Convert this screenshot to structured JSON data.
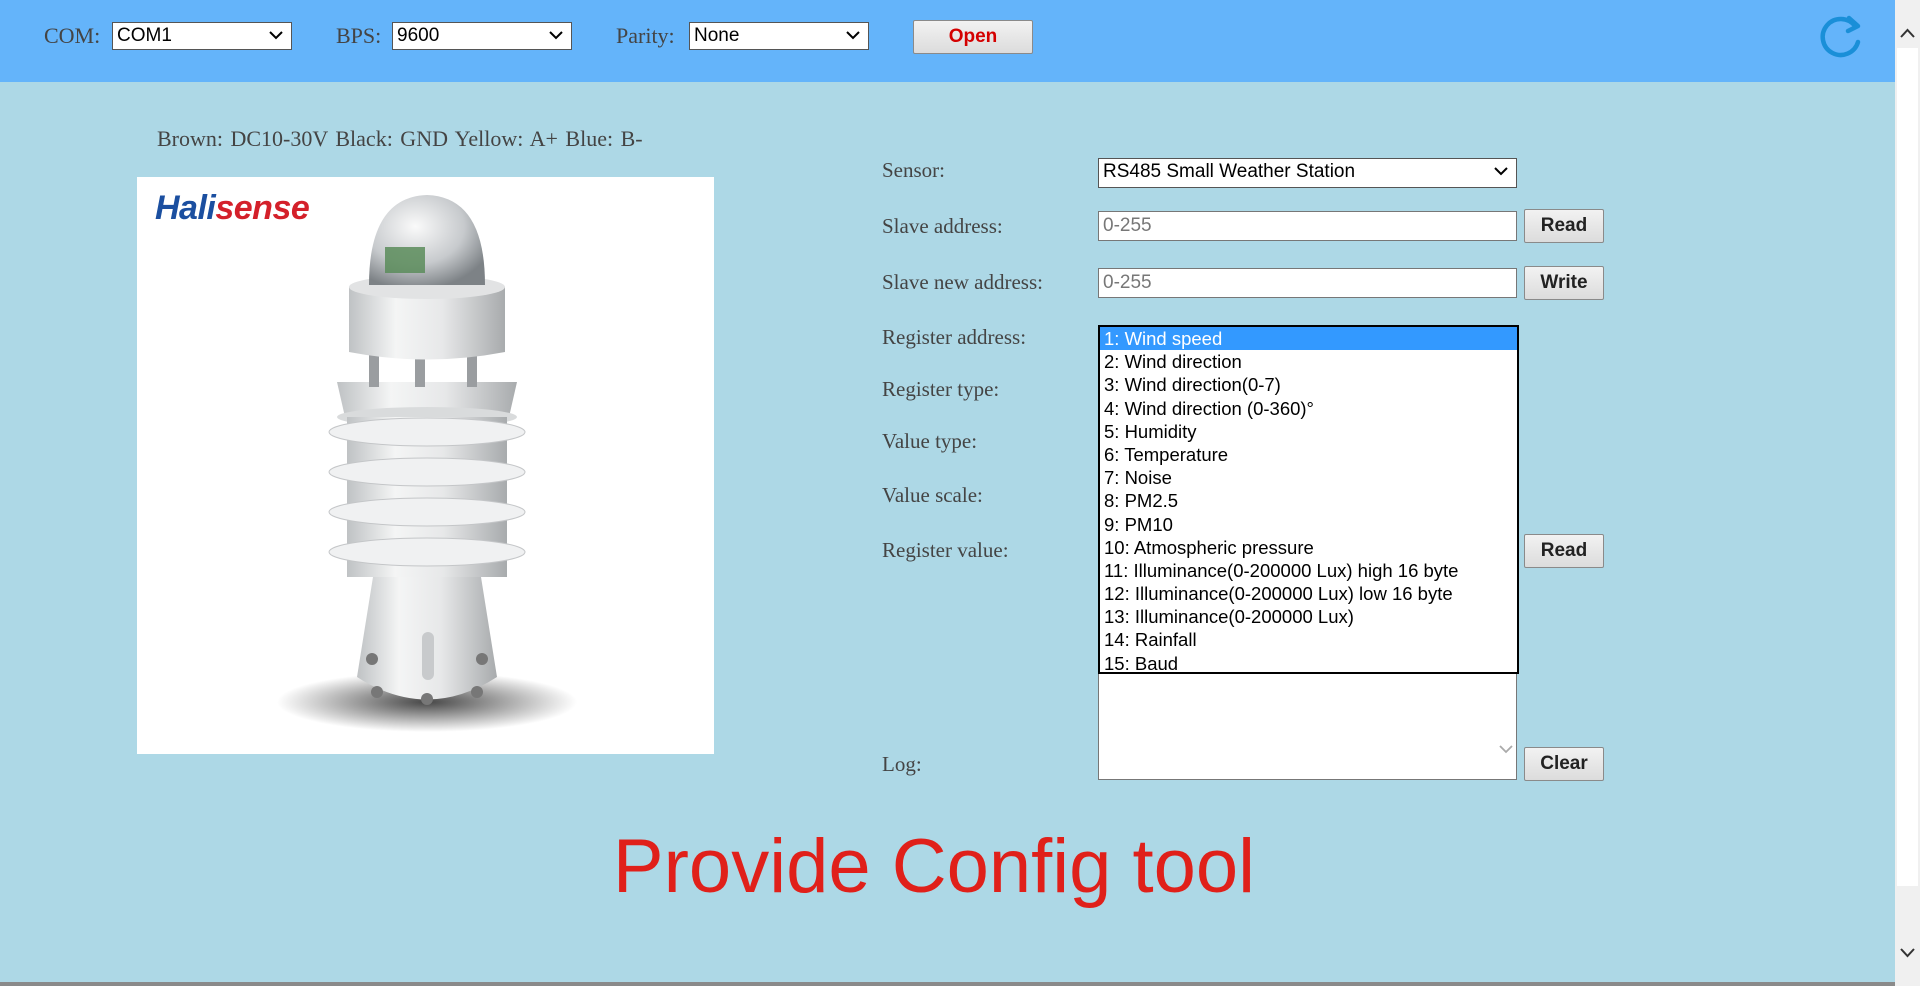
{
  "toolbar": {
    "com_label": "COM:",
    "com_value": "COM1",
    "bps_label": "BPS:",
    "bps_value": "9600",
    "parity_label": "Parity:",
    "parity_value": "None",
    "open_button": "Open",
    "refresh_icon": "refresh-icon"
  },
  "wiring_text": "Brown: DC10-30V  Black: GND  Yellow: A+  Blue: B-",
  "product_image": {
    "logo_part1": "Hali",
    "logo_part2": "sense"
  },
  "form": {
    "sensor_label": "Sensor:",
    "sensor_value": "RS485 Small Weather Station",
    "slave_address_label": "Slave address:",
    "slave_address_placeholder": "0-255",
    "read_button": "Read",
    "slave_new_address_label": "Slave new address:",
    "slave_new_address_placeholder": "0-255",
    "write_button": "Write",
    "register_address_label": "Register address:",
    "register_type_label": "Register type:",
    "value_type_label": "Value type:",
    "value_scale_label": "Value scale:",
    "register_value_label": "Register value:",
    "register_read_button": "Read",
    "log_label": "Log:",
    "clear_button": "Clear"
  },
  "register_options": [
    "1: Wind speed",
    "2: Wind direction",
    "3: Wind direction(0-7)",
    "4: Wind direction (0-360)°",
    "5: Humidity",
    "6: Temperature",
    "7: Noise",
    "8: PM2.5",
    "9: PM10",
    "10: Atmospheric pressure",
    "11: Illuminance(0-200000 Lux) high 16 byte",
    "12: Illuminance(0-200000 Lux) low 16 byte",
    "13: Illuminance(0-200000 Lux)",
    "14: Rainfall",
    "15: Baud"
  ],
  "selected_register_index": 0,
  "promo_text": "Provide Config tool",
  "colors": {
    "header_bg": "#64b4fa",
    "page_bg": "#add8e6",
    "selection": "#3399ff",
    "promo": "#e0201a"
  }
}
